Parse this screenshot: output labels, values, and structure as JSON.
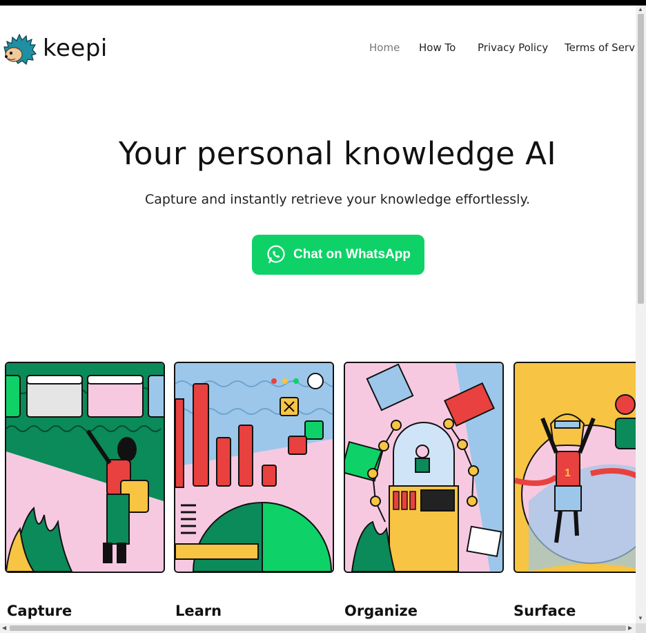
{
  "brand": {
    "name": "keepi",
    "logo_icon": "hedgehog-logo-icon"
  },
  "nav": {
    "items": [
      "Home",
      "How To",
      "Privacy Policy",
      "Terms of Service"
    ],
    "active": "Home"
  },
  "hero": {
    "title": "Your personal knowledge AI",
    "subtitle": "Capture and instantly retrieve your knowledge effortlessly.",
    "cta_label": "Chat on WhatsApp",
    "cta_icon": "whatsapp-icon"
  },
  "features": [
    {
      "title": "Capture",
      "icon": "capture-illustration"
    },
    {
      "title": "Learn",
      "icon": "learn-illustration"
    },
    {
      "title": "Organize",
      "icon": "organize-illustration"
    },
    {
      "title": "Surface",
      "icon": "surface-illustration"
    }
  ],
  "colors": {
    "accent": "#0ed267",
    "green": "#0b8a5a",
    "pink": "#f7c9e1",
    "yellow": "#f7c443",
    "red": "#e8413f",
    "blue": "#9cc7ea"
  }
}
